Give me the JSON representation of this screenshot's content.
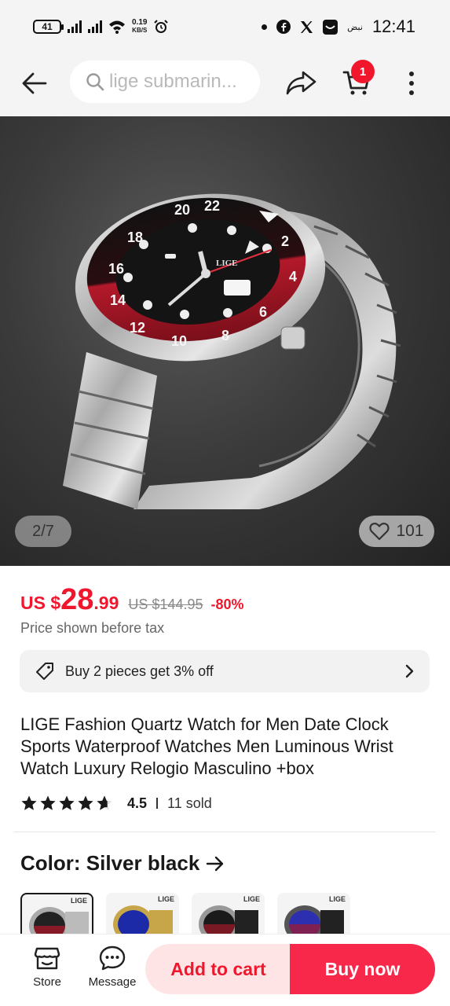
{
  "status_bar": {
    "battery": "41",
    "net_speed_value": "0.19",
    "net_speed_unit": "KB/S",
    "carrier_text": "نبض",
    "time": "12:41"
  },
  "header": {
    "search_text": "lige submarin...",
    "cart_count": "1"
  },
  "gallery": {
    "counter": "2/7",
    "wishlist_count": "101"
  },
  "price": {
    "currency": "US $",
    "main": "28",
    "decimal": ".99",
    "original": "US $144.95",
    "discount": "-80%",
    "tax_note": "Price shown before tax"
  },
  "promo": {
    "text": "Buy 2 pieces get 3% off"
  },
  "product": {
    "title": "LIGE Fashion Quartz Watch for Men Date Clock Sports Waterproof Watches Men Luminous Wrist Watch Luxury Relogio Masculino +box",
    "rating": "4.5",
    "rating_stars": 4.5,
    "sold": "11 sold"
  },
  "color": {
    "label": "Color: Silver black",
    "swatch_logo": "LIGE"
  },
  "bottom_bar": {
    "store_label": "Store",
    "message_label": "Message",
    "add_to_cart_label": "Add to cart",
    "buy_now_label": "Buy now"
  },
  "theme": {
    "accent": "#f0172c",
    "buy_now_bg": "#f7284a",
    "add_to_cart_bg": "#ffe4e6"
  }
}
